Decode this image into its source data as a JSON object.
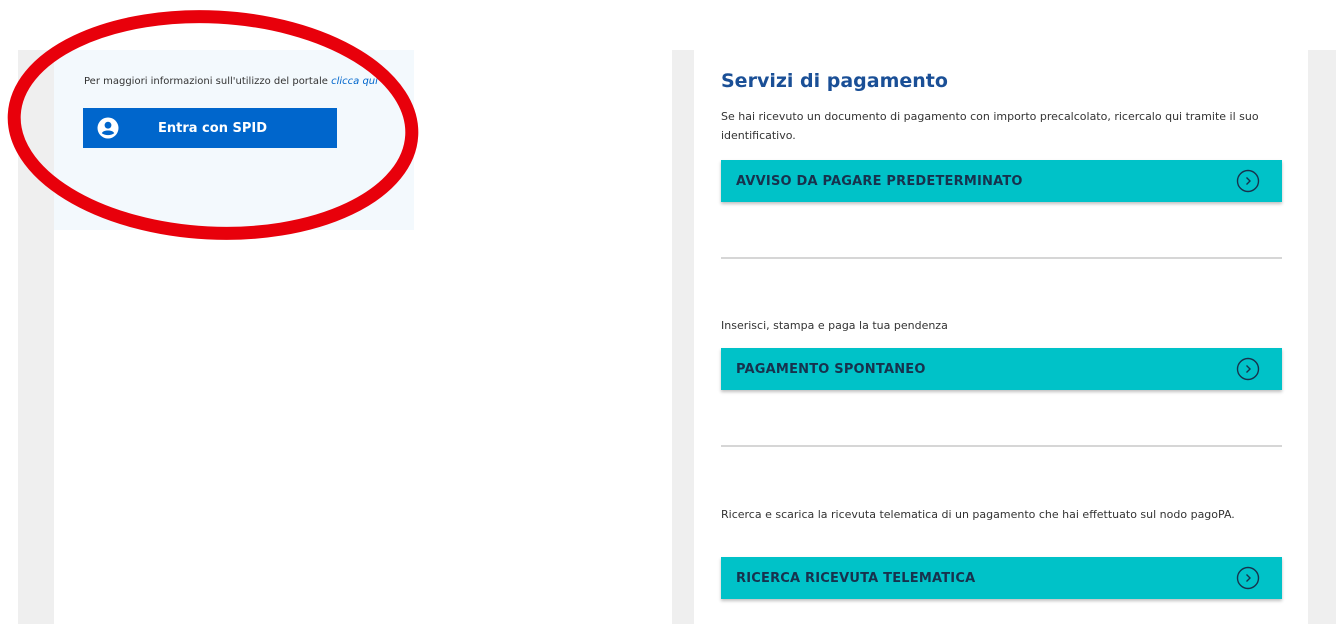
{
  "login": {
    "info_text": "Per maggiori informazioni sull'utilizzo del portale ",
    "info_link": "clicca qui",
    "spid_button": "Entra con SPID",
    "spid_icon": "user-circle-icon"
  },
  "payments": {
    "title": "Servizi di pagamento",
    "sections": [
      {
        "description": "Se hai ricevuto un documento di pagamento con importo precalcolato, ricercalo qui tramite il suo identificativo.",
        "button": "AVVISO DA PAGARE PREDETERMINATO",
        "icon": "chevron-right-circle-icon"
      },
      {
        "description": "Inserisci, stampa e paga la tua pendenza",
        "button": "PAGAMENTO SPONTANEO",
        "icon": "chevron-right-circle-icon"
      },
      {
        "description": "Ricerca e scarica la ricevuta telematica di un pagamento che hai effettuato sul nodo pagoPA.",
        "button": "RICERCA RICEVUTA TELEMATICA",
        "icon": "chevron-right-circle-icon"
      }
    ]
  },
  "colors": {
    "spid_blue": "#0066cc",
    "title_blue": "#1a4f96",
    "teal_button": "#00c2c8",
    "annotation_red": "#e8000b"
  }
}
